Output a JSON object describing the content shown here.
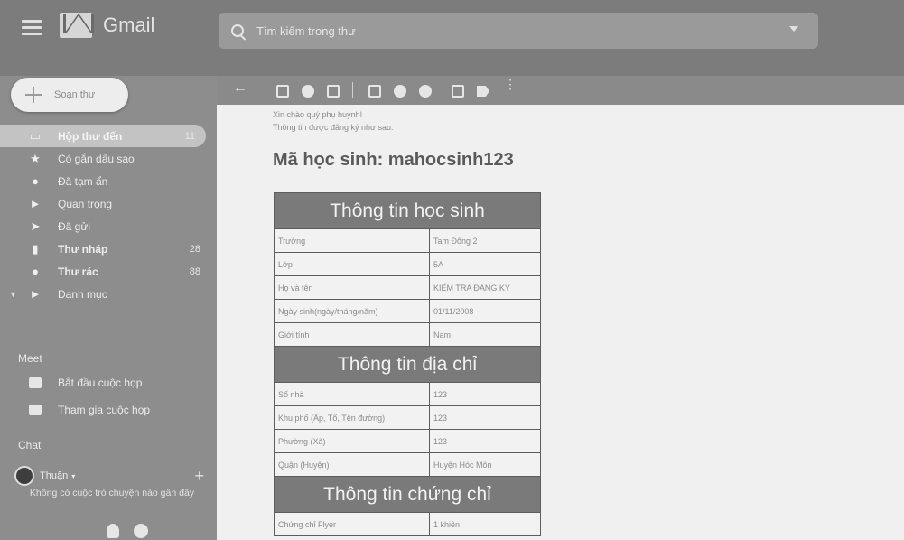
{
  "header": {
    "app_name": "Gmail",
    "search_placeholder": "Tìm kiếm trong thư"
  },
  "sidebar": {
    "compose_label": "Soạn thư",
    "items": [
      {
        "icon": "inbox-icon",
        "label": "Hộp thư đến",
        "count": "11",
        "active": true,
        "bold": true
      },
      {
        "icon": "star-icon",
        "label": "Có gắn dấu sao",
        "count": "",
        "active": false,
        "bold": false
      },
      {
        "icon": "clock-icon",
        "label": "Đã tạm ẩn",
        "count": "",
        "active": false,
        "bold": false
      },
      {
        "icon": "important-icon",
        "label": "Quan trọng",
        "count": "",
        "active": false,
        "bold": false
      },
      {
        "icon": "send-icon",
        "label": "Đã gửi",
        "count": "",
        "active": false,
        "bold": false
      },
      {
        "icon": "draft-icon",
        "label": "Thư nháp",
        "count": "28",
        "active": false,
        "bold": true
      },
      {
        "icon": "spam-icon",
        "label": "Thư rác",
        "count": "88",
        "active": false,
        "bold": true
      },
      {
        "icon": "label-icon",
        "label": "Danh mục",
        "count": "",
        "active": false,
        "bold": false
      }
    ],
    "meet": {
      "title": "Meet",
      "start_label": "Bắt đầu cuộc họp",
      "join_label": "Tham gia cuộc họp"
    },
    "chat": {
      "title": "Chat",
      "user": "Thuận",
      "note": "Không có cuộc trò chuyện nào gần đây"
    }
  },
  "message": {
    "greeting": "Xin chào quý phụ huynh!",
    "subline": "Thông tin được đăng ký như sau:",
    "student_code": "Mã học sinh: mahocsinh123",
    "sections": [
      {
        "title": "Thông tin học sinh",
        "rows": [
          [
            "Trường",
            "Tam Đông 2"
          ],
          [
            "Lớp",
            "5A"
          ],
          [
            "Họ và tên",
            "KIỂM TRA ĐĂNG KÝ"
          ],
          [
            "Ngày sinh(ngày/tháng/năm)",
            "01/11/2008"
          ],
          [
            "Giới tính",
            "Nam"
          ]
        ]
      },
      {
        "title": "Thông tin địa chỉ",
        "rows": [
          [
            "Số nhà",
            "123"
          ],
          [
            "Khu phố (Ấp, Tổ, Tên đường)",
            "123"
          ],
          [
            "Phường (Xã)",
            "123"
          ],
          [
            "Quận (Huyện)",
            "Huyện Hóc Môn"
          ]
        ]
      },
      {
        "title": "Thông tin chứng chỉ",
        "rows": [
          [
            "Chứng chỉ Flyer",
            "1 khiên"
          ]
        ]
      }
    ]
  }
}
